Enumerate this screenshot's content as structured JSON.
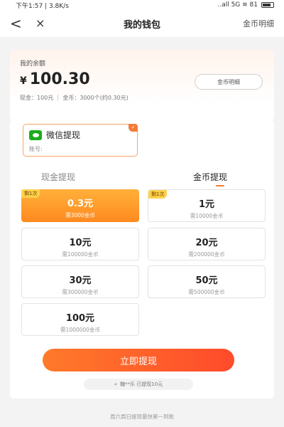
{
  "status_bar": {
    "left": "下午1:57 | 3.8K/s",
    "right": "..all 5G ≋ 81"
  },
  "nav": {
    "back": "<",
    "close": "×",
    "title": "我的钱包",
    "right_link": "金币明细"
  },
  "balance": {
    "label": "我的余额",
    "currency": "¥",
    "amount": "100.30",
    "sub": "现金：100元 ｜ 金币：3000个(约0.30元)",
    "detail_button": "金币明细"
  },
  "method": {
    "name": "微信提现",
    "account": "账号:",
    "check": "✓"
  },
  "tabs": {
    "cash": "现金提现",
    "coin": "金币提现"
  },
  "options": [
    {
      "amount": "0.3元",
      "cost": "需3000金币",
      "badge": "剩1次"
    },
    {
      "amount": "1元",
      "cost": "需10000金币",
      "badge": "剩1次"
    },
    {
      "amount": "10元",
      "cost": "需100000金币"
    },
    {
      "amount": "20元",
      "cost": "需200000金币"
    },
    {
      "amount": "30元",
      "cost": "需300000金币"
    },
    {
      "amount": "50元",
      "cost": "需500000金币"
    },
    {
      "amount": "100元",
      "cost": "需1000000金币"
    }
  ],
  "cta": "立即提现",
  "notice": {
    "icon": "«",
    "text": "糖**乐 已提现10元"
  },
  "footer": "周六周日提现最快第一到账",
  "colors": {
    "accent": "#f47b37",
    "wechat": "#1aad19"
  }
}
